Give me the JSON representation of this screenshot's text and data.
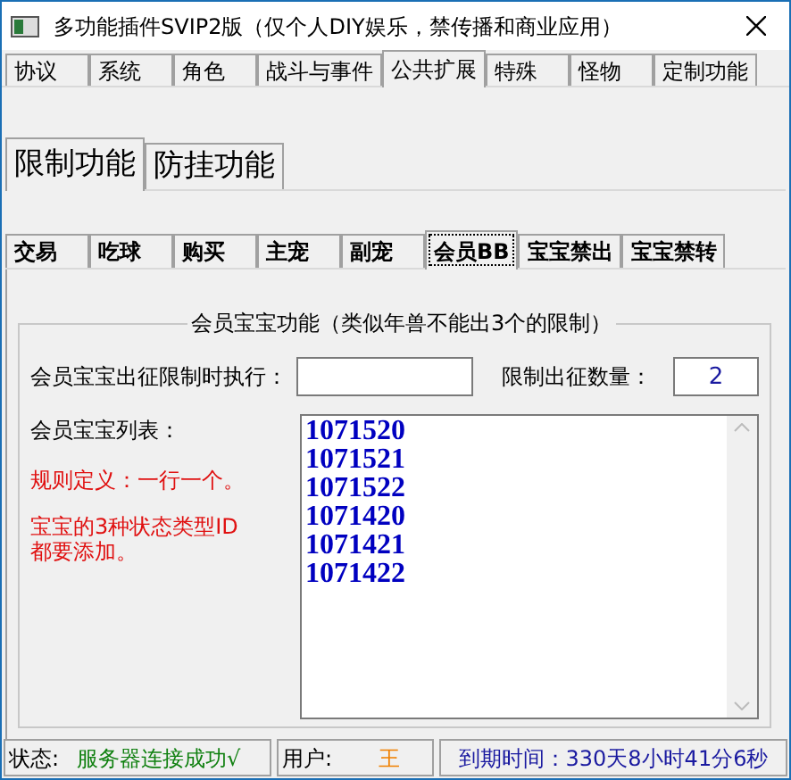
{
  "window": {
    "title": "多功能插件SVIP2版（仅个人DIY娱乐，禁传播和商业应用）"
  },
  "main_tabs": [
    {
      "label": "协议",
      "selected": false
    },
    {
      "label": "系统",
      "selected": false
    },
    {
      "label": "角色",
      "selected": false
    },
    {
      "label": "战斗与事件",
      "selected": false
    },
    {
      "label": "公共扩展",
      "selected": true
    },
    {
      "label": "特殊",
      "selected": false
    },
    {
      "label": "怪物",
      "selected": false
    },
    {
      "label": "定制功能",
      "selected": false
    }
  ],
  "sub_tabs": [
    {
      "label": "限制功能",
      "selected": true
    },
    {
      "label": "防挂功能",
      "selected": false
    }
  ],
  "inner_tabs": [
    {
      "label": "交易",
      "selected": false
    },
    {
      "label": "吃球",
      "selected": false
    },
    {
      "label": "购买",
      "selected": false
    },
    {
      "label": "主宠",
      "selected": false
    },
    {
      "label": "副宠",
      "selected": false
    },
    {
      "label": "会员BB",
      "selected": true
    },
    {
      "label": "宝宝禁出",
      "selected": false
    },
    {
      "label": "宝宝禁转",
      "selected": false
    }
  ],
  "group": {
    "title": "会员宝宝功能（类似年兽不能出3个的限制）",
    "exec_label": "会员宝宝出征限制时执行：",
    "limit_label": "限制出征数量：",
    "limit_value": "2",
    "list_label": "会员宝宝列表：",
    "rule_text": "规则定义：一行一个。",
    "note_text": "宝宝的3种状态类型ID都要添加。",
    "list_items": [
      "1071520",
      "1071521",
      "1071522",
      "1071420",
      "1071421",
      "1071422"
    ]
  },
  "status_bar": {
    "status_label": "状态:",
    "status_value": "服务器连接成功√",
    "user_label": "用户:",
    "user_value": "王",
    "expiry": "到期时间：330天8小时41分6秒"
  }
}
